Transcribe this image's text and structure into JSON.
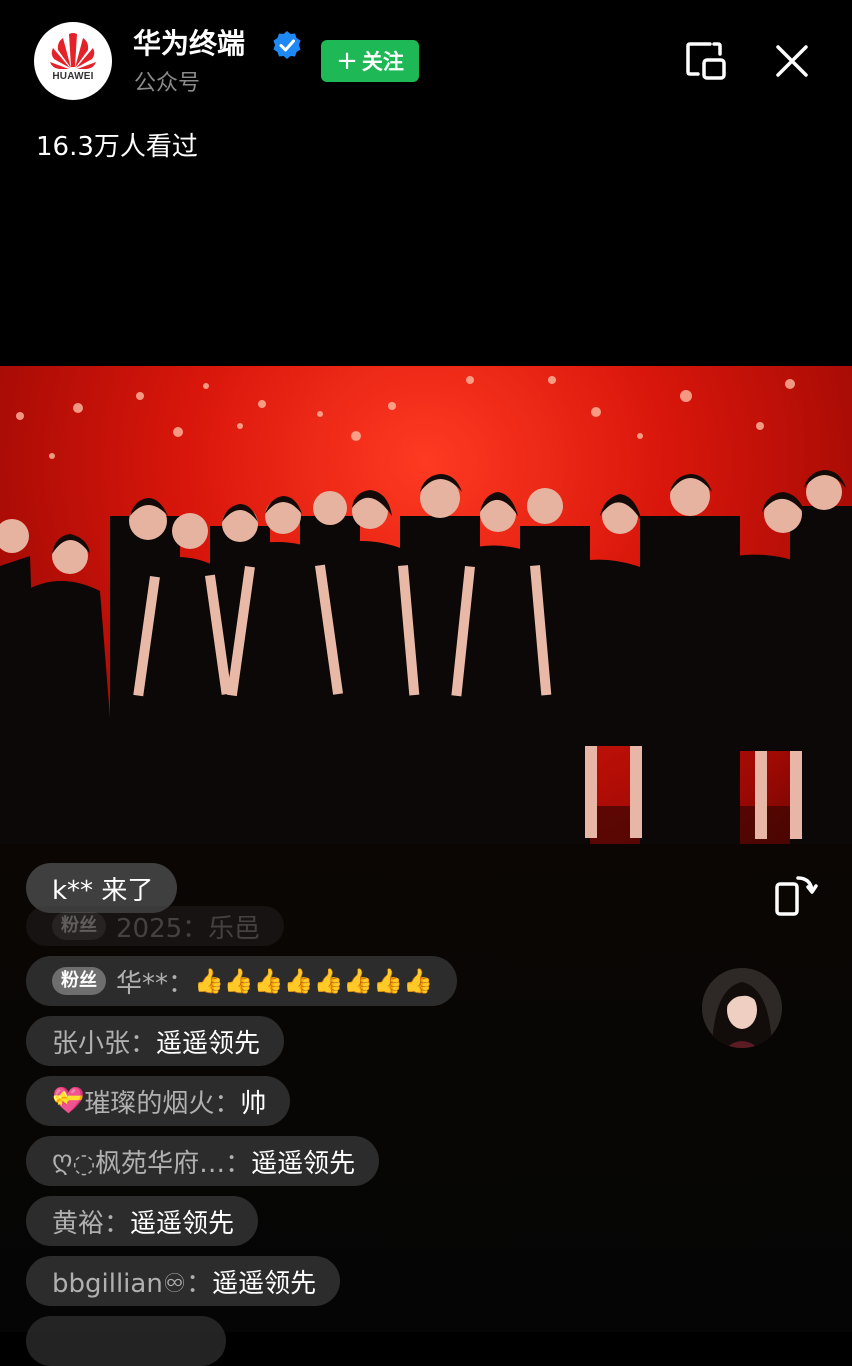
{
  "header": {
    "avatar_brand": "HUAWEI",
    "account_name": "华为终端",
    "account_type": "公众号",
    "follow_label": "关注",
    "follow_plus": "+",
    "verified_color": "#1e88f5",
    "follow_color": "#1fb857"
  },
  "viewers": "16.3万人看过",
  "comments": {
    "join_message": "k** 来了",
    "ghost": {
      "badge": "粉丝",
      "text": "2025：乐邑"
    },
    "items": [
      {
        "badge": "粉丝",
        "user": "华**：",
        "msg": "👍👍👍👍👍👍👍👍"
      },
      {
        "user": "张小张：",
        "msg": "遥遥领先"
      },
      {
        "prefix": "💝",
        "user": "璀璨的烟火：",
        "msg": "帅"
      },
      {
        "prefix": "ღ",
        "user": "◌枫苑华府…：",
        "msg": "遥遥领先"
      },
      {
        "user": "黄裕：",
        "msg": "遥遥领先"
      },
      {
        "user": "bbgillian♾：",
        "msg": "遥遥领先"
      }
    ]
  },
  "icons": [
    "huawei-logo-icon",
    "verified-icon",
    "floating-window-icon",
    "close-icon",
    "rotate-screen-icon"
  ]
}
